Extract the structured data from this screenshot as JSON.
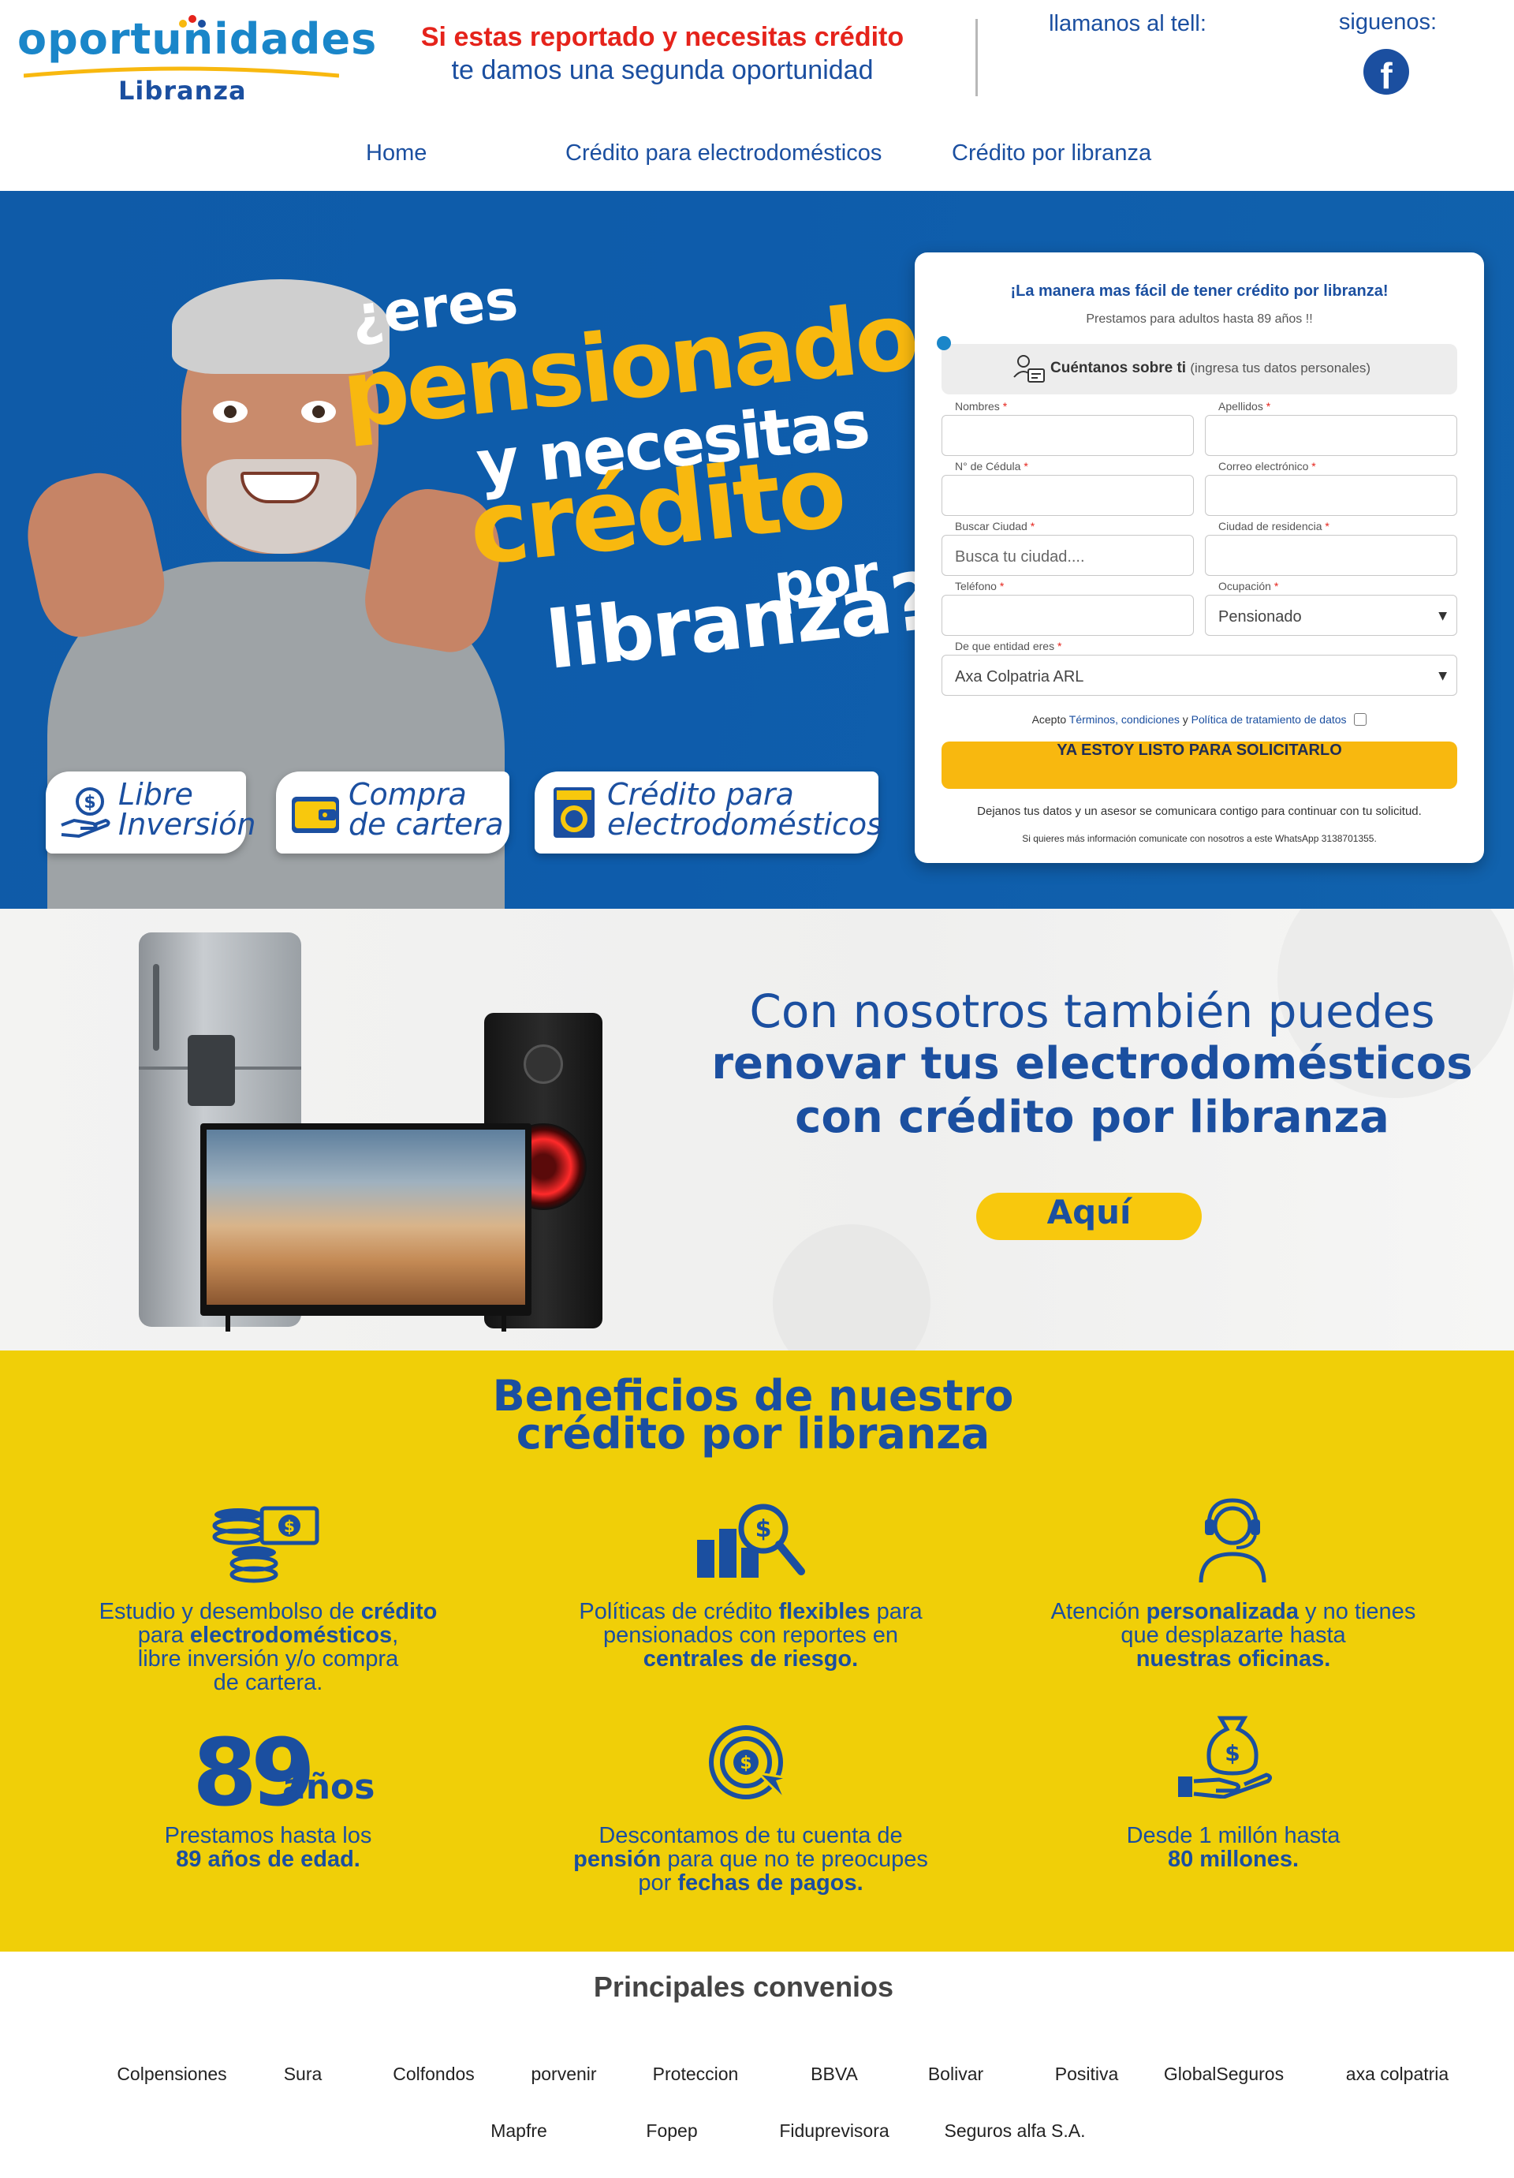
{
  "header": {
    "logo_main": "oportunidades",
    "logo_sub": "Libranza",
    "tagline_line1": "Si estas reportado y necesitas crédito",
    "tagline_line2": "te damos una segunda oportunidad",
    "call_label": "llamanos al tell:",
    "follow_label": "siguenos:",
    "facebook_glyph": "f",
    "nav": [
      {
        "label": "Home"
      },
      {
        "label": "Crédito para electrodomésticos"
      },
      {
        "label": "Crédito por libranza"
      }
    ]
  },
  "hero": {
    "headline": [
      "¿eres",
      "pensionado",
      "y necesitas",
      "crédito",
      "por",
      "libranza?"
    ],
    "pills": [
      {
        "line1": "Libre",
        "line2": "Inversión",
        "icon": "hand-coin-icon"
      },
      {
        "line1": "Compra",
        "line2": "de cartera",
        "icon": "wallet-icon"
      },
      {
        "line1": "Crédito para",
        "line2": "electrodomésticos",
        "icon": "washing-machine-icon"
      }
    ]
  },
  "form": {
    "title": "¡La manera mas fácil de tener crédito por libranza!",
    "subtitle": "Prestamos para adultos hasta 89 años !!",
    "tell_us": "Cuéntanos sobre ti",
    "tell_us_note": "(ingresa tus datos personales)",
    "fields": [
      {
        "label": "Nombres",
        "value": ""
      },
      {
        "label": "Apellidos",
        "value": ""
      },
      {
        "label": "N° de Cédula",
        "value": ""
      },
      {
        "label": "Correo electrónico",
        "value": ""
      },
      {
        "label": "Buscar Ciudad",
        "value": "",
        "placeholder": "Busca tu ciudad...."
      },
      {
        "label": "Ciudad de residencia",
        "value": ""
      },
      {
        "label": "Teléfono",
        "value": ""
      },
      {
        "label": "Ocupación",
        "value": "Pensionado"
      },
      {
        "label": "De que entidad eres",
        "value": "Axa Colpatria ARL"
      }
    ],
    "required_mark": "*",
    "terms_prefix": "Acepto",
    "terms_link1": "Términos, condiciones",
    "terms_and": "y",
    "terms_link2": "Política de tratamiento de datos",
    "submit_label": "YA ESTOY LISTO PARA SOLICITARLO",
    "note1": "Dejanos tus datos y un asesor se comunicara contigo para continuar con tu solicitud.",
    "note2": "Si quieres más información comunicate con nosotros a este WhatsApp 3138701355."
  },
  "appliances": {
    "line1": "Con nosotros también puedes",
    "line2": "renovar tus electrodomésticos",
    "line3": "con crédito por libranza",
    "button_label": "Aquí"
  },
  "benefits": {
    "title_line1": "Beneficios de nuestro",
    "title_line2": "crédito por libranza",
    "big_number": "89",
    "big_number_unit": "años",
    "items": [
      {
        "icon": "coins-money-icon",
        "segments": [
          [
            "Estudio y desembolso de ",
            false
          ],
          [
            "crédito",
            true
          ],
          [
            "\npara ",
            false
          ],
          [
            "electrodomésticos",
            true
          ],
          [
            ",\nlibre inversión y/o compra\nde cartera.",
            false
          ]
        ]
      },
      {
        "icon": "chart-search-icon",
        "segments": [
          [
            "Políticas de crédito ",
            false
          ],
          [
            "flexibles",
            true
          ],
          [
            " para\npensionados con reportes en\n",
            false
          ],
          [
            "centrales de riesgo.",
            true
          ]
        ]
      },
      {
        "icon": "headset-agent-icon",
        "segments": [
          [
            "Atención ",
            false
          ],
          [
            "personalizada",
            true
          ],
          [
            " y no tienes\nque desplazarte hasta\n",
            false
          ],
          [
            "nuestras oficinas.",
            true
          ]
        ]
      },
      {
        "icon": "age-89-icon",
        "segments": [
          [
            "Prestamos hasta los\n",
            false
          ],
          [
            "89 años de edad.",
            true
          ]
        ]
      },
      {
        "icon": "target-dollar-icon",
        "segments": [
          [
            "Descontamos de tu cuenta de\n",
            false
          ],
          [
            "pensión",
            true
          ],
          [
            " para que no te preocupes\npor ",
            false
          ],
          [
            "fechas de pagos.",
            true
          ]
        ]
      },
      {
        "icon": "money-bag-hand-icon",
        "segments": [
          [
            "Desde 1 millón hasta\n",
            false
          ],
          [
            "80 millones.",
            true
          ]
        ]
      }
    ]
  },
  "convenios": {
    "title": "Principales convenios",
    "row1": [
      "Colpensiones",
      "Sura",
      "Colfondos",
      "porvenir",
      "Proteccion",
      "BBVA",
      "Bolivar",
      "Positiva",
      "GlobalSeguros",
      "axa colpatria"
    ],
    "row2": [
      "Mapfre",
      "Fopep",
      "Fiduprevisora",
      "Seguros alfa S.A."
    ]
  },
  "colors": {
    "brand_blue": "#1b4fa0",
    "logo_blue": "#1a86c9",
    "hero_blue": "#0e5cab",
    "accent_yellow": "#f8b80f",
    "benefits_yellow": "#f0cf08",
    "alert_red": "#e5231b"
  }
}
